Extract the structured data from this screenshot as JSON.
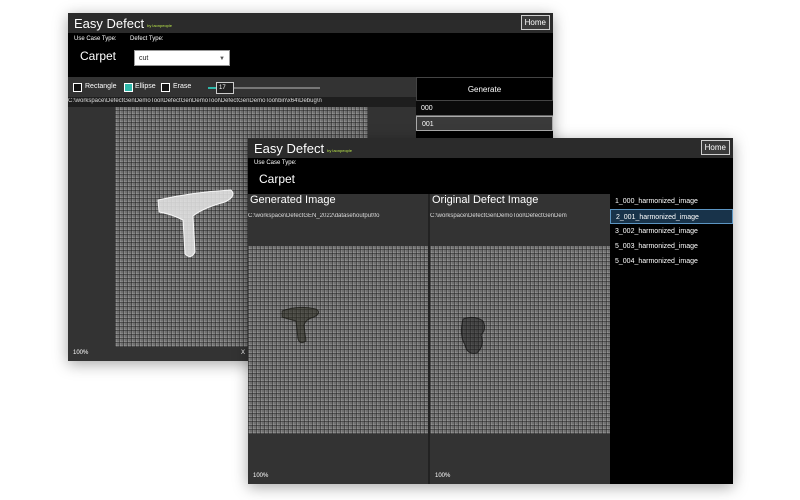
{
  "back_window": {
    "title": "Easy Defect",
    "subtitle": "by laonpeople",
    "home_label": "Home",
    "use_case_label": "Use Case Type:",
    "use_case_value": "Carpet",
    "defect_type_label": "Defect Type:",
    "defect_type_value": "cut",
    "tools": [
      {
        "label": "Rectangle",
        "checked": false
      },
      {
        "label": "Ellipse",
        "checked": true
      },
      {
        "label": "Erase",
        "checked": false
      }
    ],
    "brush_size": "17",
    "path": "C:\\workspace\\DefectGenDemoTool\\DefectGenDemoTool\\DefectGenDemoTool\\bin\\x64\\Debug\\n",
    "zoom": "100%",
    "canvas_marker": "X",
    "generate_label": "Generate",
    "list": [
      "000",
      "001"
    ],
    "selected_index": 1
  },
  "front_window": {
    "title": "Easy Defect",
    "subtitle": "by laonpeople",
    "home_label": "Home",
    "use_case_label": "Use Case Type:",
    "use_case_value": "Carpet",
    "generated_header": "Generated Image",
    "original_header": "Original Defect Image",
    "generated_path": "C:\\workspace\\DefectGEN_2022\\dataset\\output\\fo",
    "original_path": "C:\\workspace\\DefectGenDemoTool\\DefectGenDem",
    "zoom": "100%",
    "results": [
      "1_000_harmonized_image",
      "2_001_harmonized_image",
      "3_002_harmonized_image",
      "5_003_harmonized_image",
      "5_004_harmonized_image"
    ],
    "selected_index": 1
  },
  "colors": {
    "accent": "#2fb7a9",
    "subtitle": "#b7e34a",
    "selection": "#18334a"
  }
}
